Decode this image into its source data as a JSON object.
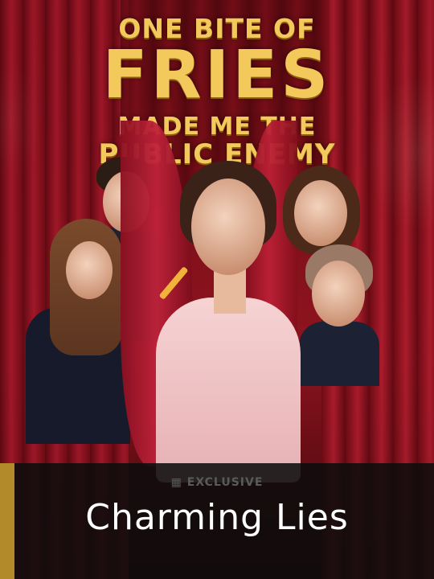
{
  "poster": {
    "title_line1": "ONE BITE OF",
    "title_line2": "FRIES",
    "title_line3": "MADE ME THE",
    "title_line4": "PUBLIC ENEMY"
  },
  "badge": {
    "icon": "film-icon",
    "label": "EXCLUSIVE"
  },
  "show_title": "Charming Lies",
  "colors": {
    "title_gold": "#f2c95a",
    "curtain_red": "#a3182a",
    "banner_bg": "#0c0c0c",
    "accent_gold": "#b28a2a",
    "label_gray": "#5a5a5a"
  }
}
